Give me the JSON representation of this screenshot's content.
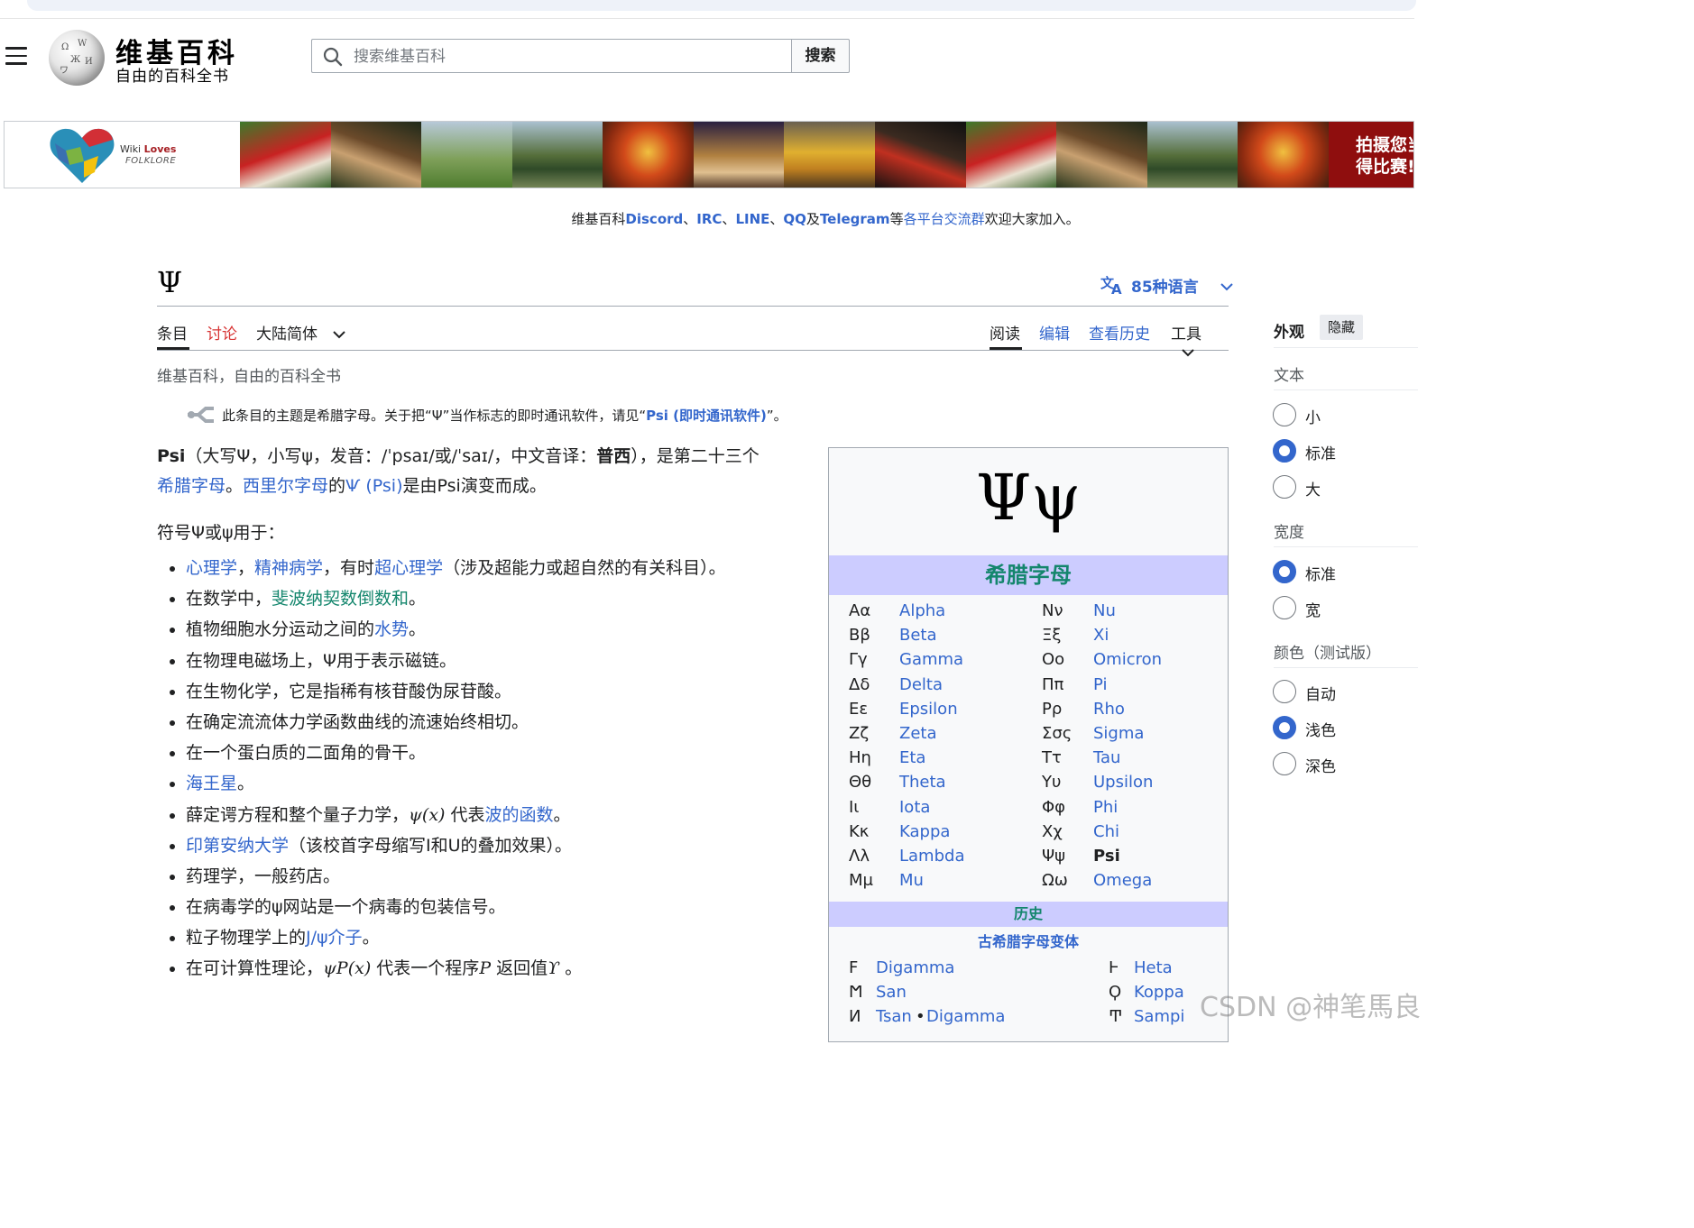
{
  "header": {
    "logo_wordmark": "维基百科",
    "logo_tagline": "自由的百科全书",
    "search_placeholder": "搜索维基百科",
    "search_button": "搜索"
  },
  "banner": {
    "brand_prefix": "Wiki",
    "brand_loves": "Loves",
    "brand_folklore": "FOLKLORE",
    "cta_line1": "拍摄您当",
    "cta_line2": "得比赛!"
  },
  "sitenotice": {
    "prefix": "维基百科",
    "discord": "Discord",
    "sep1": "、",
    "irc": "IRC",
    "sep2": "、",
    "line": "LINE",
    "sep3": "、",
    "qq": "QQ",
    "and": "及",
    "telegram": "Telegram",
    "etc": "等",
    "groups_link": "各平台交流群",
    "suffix": "欢迎大家加入。"
  },
  "article": {
    "title": "Ψ",
    "languages": "85种语言",
    "tabs_left": {
      "article": "条目",
      "talk": "讨论",
      "variant": "大陆简体"
    },
    "tabs_right": {
      "read": "阅读",
      "edit": "编辑",
      "history": "查看历史",
      "tools": "工具"
    },
    "sitesub": "维基百科，自由的百科全书",
    "hatnote": {
      "text": "此条目的主题是希腊字母。关于把“Ψ”当作标志的即时通讯软件，请见“",
      "link": "Psi (即时通讯软件)",
      "end": "”。"
    },
    "lead": {
      "psi": "Psi",
      "part1": "（大写Ψ，小写ψ，发音：/ˈpsaɪ/或/ˈsaɪ/，中文音译：",
      "puxi": "普西",
      "part2": "），是第二十三个",
      "greek_link": "希腊字母",
      "sep": "。",
      "cyrillic_link": "西里尔字母",
      "of": "的",
      "psi_cyr_link": "Ѱ (Psi)",
      "part3": "是由Psi演变而成。"
    },
    "uses_heading": "符号Ψ或ψ用于：",
    "uses": {
      "u1": {
        "l1": "心理学",
        "s1": "，",
        "l2": "精神病学",
        "s2": "，有时",
        "l3": "超心理学",
        "s3": "（涉及超能力或超自然的有关科目）。"
      },
      "u2": {
        "t1": "在数学中，",
        "l1": "斐波纳契数倒数和",
        "t2": "。"
      },
      "u3": {
        "t1": "植物细胞水分运动之间的",
        "l1": "水势",
        "t2": "。"
      },
      "u4": "在物理电磁场上，Ψ用于表示磁链。",
      "u5": "在生物化学，它是指稀有核苷酸伪尿苷酸。",
      "u6": "在确定流流体力学函数曲线的流速始终相切。",
      "u7": "在一个蛋白质的二面角的骨干。",
      "u8": {
        "l1": "海王星",
        "t1": "。"
      },
      "u9": {
        "t1": "薛定谔方程和整个量子力学，",
        "m1": "ψ(x)",
        "t2": "代表",
        "l1": "波的函数",
        "t3": "。"
      },
      "u10": {
        "l1": "印第安纳大学",
        "t1": "（该校首字母缩写I和U的叠加效果）。"
      },
      "u11": "药理学，一般药店。",
      "u12": "在病毒学的ψ网站是一个病毒的包装信号。",
      "u13": {
        "t1": "粒子物理学上的",
        "l1": "J/ψ介子",
        "t2": "。"
      },
      "u14": {
        "t1": "在可计算性理论，",
        "m1": "ψP(x)",
        "t2": "代表一个程序",
        "m2": "P",
        "t3": "返回值",
        "m3": "ϒ",
        "t4": "。"
      }
    }
  },
  "infobox": {
    "glyph": "Ψψ",
    "header": "希腊字母",
    "letters_left": [
      [
        "Αα",
        "Alpha"
      ],
      [
        "Ββ",
        "Beta"
      ],
      [
        "Γγ",
        "Gamma"
      ],
      [
        "Δδ",
        "Delta"
      ],
      [
        "Εε",
        "Epsilon"
      ],
      [
        "Ζζ",
        "Zeta"
      ],
      [
        "Ηη",
        "Eta"
      ],
      [
        "Θθ",
        "Theta"
      ],
      [
        "Ιι",
        "Iota"
      ],
      [
        "Κκ",
        "Kappa"
      ],
      [
        "Λλ",
        "Lambda"
      ],
      [
        "Μμ",
        "Mu"
      ]
    ],
    "letters_right": [
      [
        "Νν",
        "Nu"
      ],
      [
        "Ξξ",
        "Xi"
      ],
      [
        "Οο",
        "Omicron"
      ],
      [
        "Ππ",
        "Pi"
      ],
      [
        "Ρρ",
        "Rho"
      ],
      [
        "Σσς",
        "Sigma"
      ],
      [
        "Ττ",
        "Tau"
      ],
      [
        "Υυ",
        "Upsilon"
      ],
      [
        "Φφ",
        "Phi"
      ],
      [
        "Χχ",
        "Chi"
      ],
      [
        "Ψψ",
        "Psi"
      ],
      [
        "Ωω",
        "Omega"
      ]
    ],
    "history_header": "历史",
    "archaic_header": "古希腊字母变体",
    "archaic": {
      "r1": {
        "g1": "Ϝ",
        "n1": "Digamma",
        "g2": "Ͱ",
        "n2": "Heta"
      },
      "r2": {
        "g1": "Ϻ",
        "n1": "San",
        "g2": "Ϙ",
        "n2": "Koppa"
      },
      "r3": {
        "g1": "Ͷ",
        "n1": "Tsan",
        "dot": "•",
        "n1b": "Digamma",
        "g2": "Ͳ",
        "n2": "Sampi"
      }
    }
  },
  "appearance": {
    "title": "外观",
    "hide": "隐藏",
    "text_label": "文本",
    "text_options": [
      "小",
      "标准",
      "大"
    ],
    "text_selected": "标准",
    "width_label": "宽度",
    "width_options": [
      "标准",
      "宽"
    ],
    "width_selected": "标准",
    "color_label": "颜色（测试版）",
    "color_options": [
      "自动",
      "浅色",
      "深色"
    ],
    "color_selected": "浅色"
  },
  "watermark": "CSDN @神笔馬良",
  "colors": {
    "link": "#3366cc",
    "link_green": "#14866d",
    "infobox_header": "#ccccff",
    "banner_cta": "#8f0e0e"
  }
}
